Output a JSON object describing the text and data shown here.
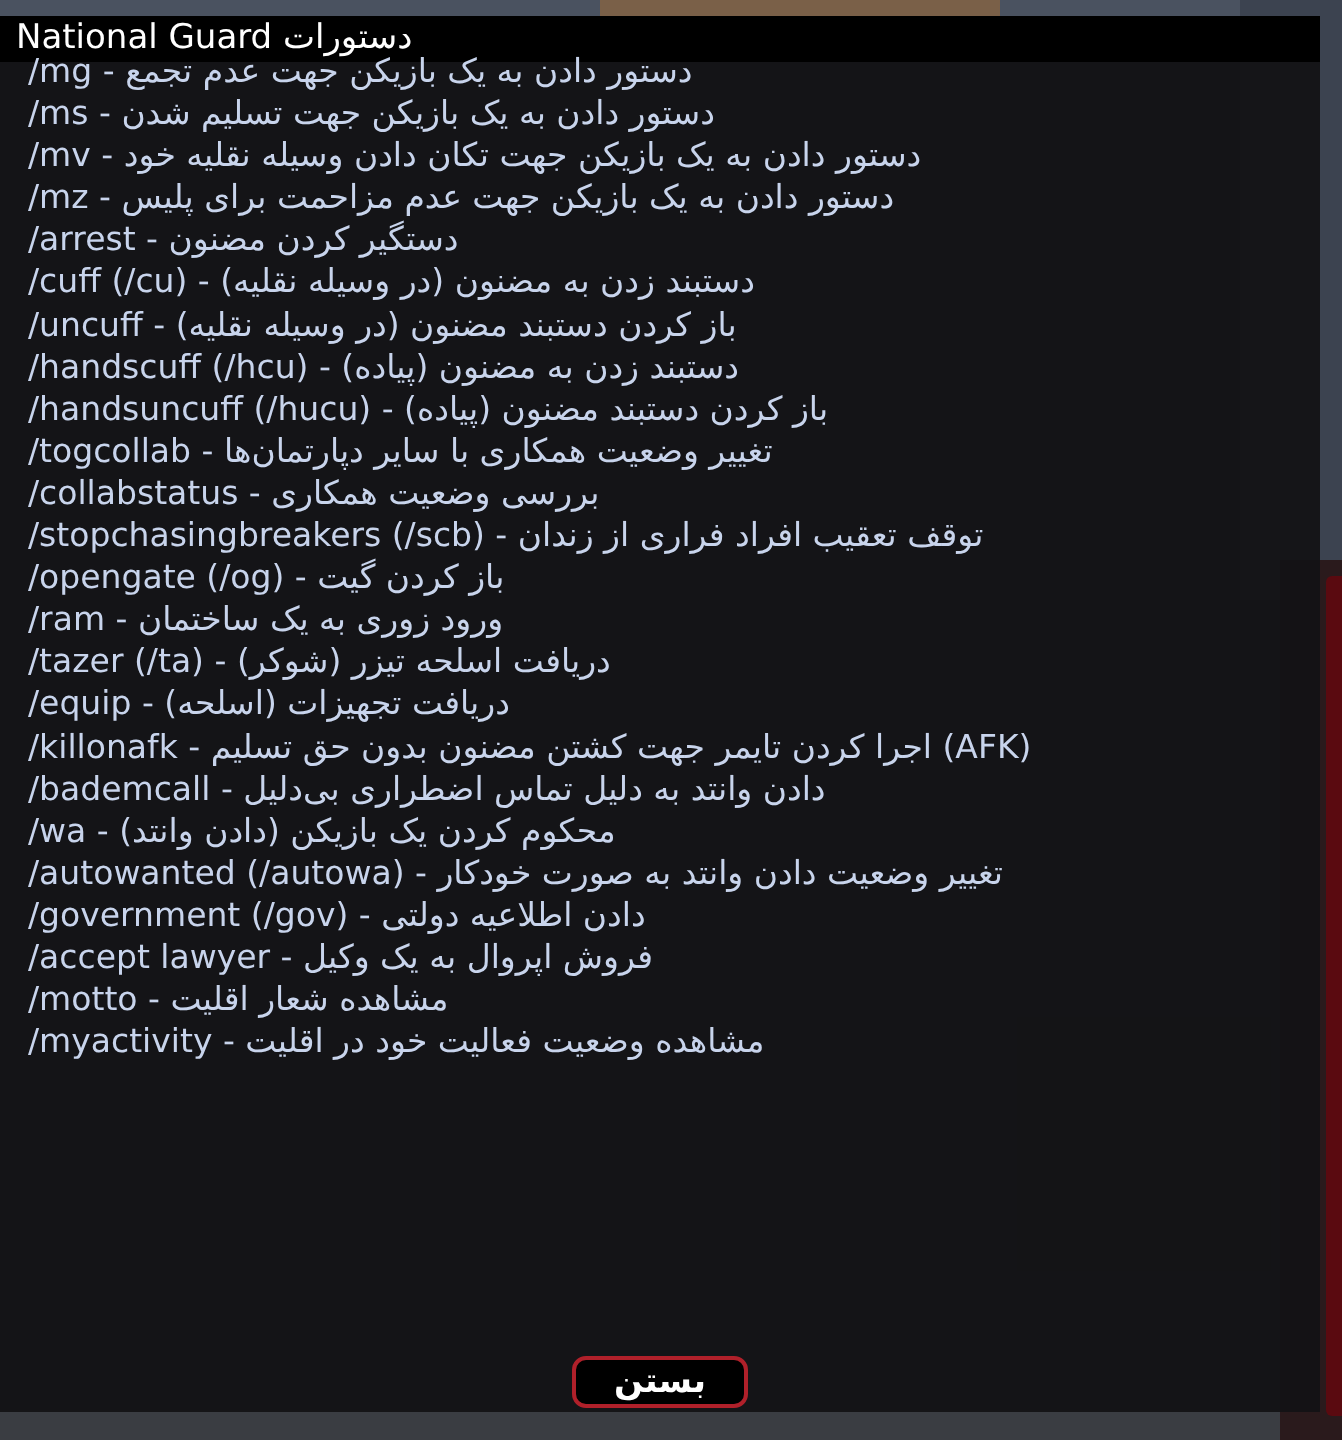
{
  "dialog": {
    "title": "National Guard دستورات",
    "lines": [
      {
        "command": "/mg",
        "separator": "-",
        "description": "دستور دادن به یک بازیکن جهت عدم تجمع"
      },
      {
        "command": "/ms",
        "separator": "-",
        "description": "دستور دادن به یک بازیکن جهت تسلیم شدن"
      },
      {
        "command": "/mv",
        "separator": "-",
        "description": "دستور دادن به یک بازیکن جهت تکان دادن وسیله نقلیه خود"
      },
      {
        "command": "/mz",
        "separator": "-",
        "description": "دستور دادن به یک بازیکن جهت عدم مزاحمت برای پلیس"
      },
      {
        "command": "/arrest",
        "separator": "-",
        "description": "دستگیر کردن مضنون"
      },
      {
        "command": "/cuff (/cu)",
        "separator": "-",
        "description": "دستبند زدن به مضنون (در وسیله نقلیه)"
      },
      {
        "command": "/uncuff",
        "separator": "-",
        "description": "باز کردن دستبند مضنون (در وسیله نقلیه)"
      },
      {
        "command": "/handscuff (/hcu)",
        "separator": "-",
        "description": "دستبند زدن به مضنون (پیاده)"
      },
      {
        "command": "/handsuncuff (/hucu)",
        "separator": "-",
        "description": "باز کردن دستبند مضنون (پیاده)"
      },
      {
        "command": "/togcollab",
        "separator": "-",
        "description": "تغییر وضعیت همکاری با سایر دپارتمان‌ها"
      },
      {
        "command": "/collabstatus",
        "separator": "-",
        "description": "بررسی وضعیت همکاری"
      },
      {
        "command": "/stopchasingbreakers (/scb)",
        "separator": "-",
        "description": "توقف تعقیب افراد فراری از زندان"
      },
      {
        "command": "/opengate (/og)",
        "separator": "-",
        "description": "باز کردن گیت"
      },
      {
        "command": "/ram",
        "separator": "-",
        "description": "ورود زوری به یک ساختمان"
      },
      {
        "command": "/tazer (/ta)",
        "separator": "-",
        "description": "دریافت اسلحه تیزر (شوکر)"
      },
      {
        "command": "/equip",
        "separator": "-",
        "description": "دریافت تجهیزات (اسلحه)"
      },
      {
        "command": "/killonafk",
        "separator": "-",
        "description": "(AFK) اجرا کردن تایمر جهت کشتن مضنون بدون حق تسلیم"
      },
      {
        "command": "/bademcall",
        "separator": "-",
        "description": "دادن وانتد به دلیل تماس اضطراری بی‌دلیل"
      },
      {
        "command": "/wa",
        "separator": "-",
        "description": "محکوم کردن یک بازیکن (دادن وانتد)"
      },
      {
        "command": "/autowanted (/autowa)",
        "separator": "-",
        "description": "تغییر وضعیت دادن وانتد به صورت خودکار"
      },
      {
        "command": "/government (/gov)",
        "separator": "-",
        "description": "دادن اطلاعیه دولتی"
      },
      {
        "command": "/accept lawyer",
        "separator": "-",
        "description": "فروش اپروال به یک وکیل"
      },
      {
        "command": "/motto",
        "separator": "-",
        "description": "مشاهده شعار اقلیت"
      },
      {
        "command": "/myactivity",
        "separator": "-",
        "description": "مشاهده وضعیت فعالیت خود در اقلیت"
      }
    ],
    "button": "بستن"
  }
}
